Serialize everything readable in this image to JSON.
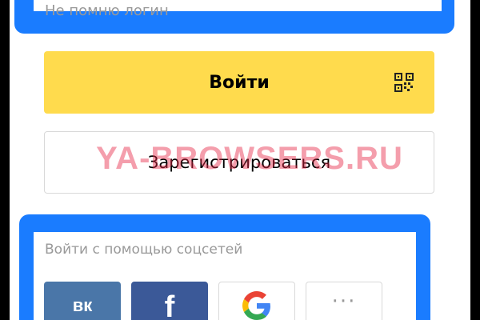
{
  "form": {
    "forgot_login_link": "Не помню логин",
    "login_label": "Войти",
    "register_label": "Зарегистрироваться",
    "qr_icon": "qr-code-icon"
  },
  "watermark": {
    "text": "YA-BROWSERS.RU"
  },
  "social": {
    "title": "Войти с помощью соцсетей",
    "buttons": [
      {
        "name": "vk",
        "label": "вк",
        "color": "#4a76a8"
      },
      {
        "name": "facebook",
        "label": "f",
        "color": "#3b5998"
      },
      {
        "name": "google",
        "icon": "google-g-icon"
      },
      {
        "name": "more",
        "label": "···"
      }
    ]
  },
  "colors": {
    "accent_yellow": "#ffdb4d",
    "highlight_blue": "#1a7cff"
  }
}
